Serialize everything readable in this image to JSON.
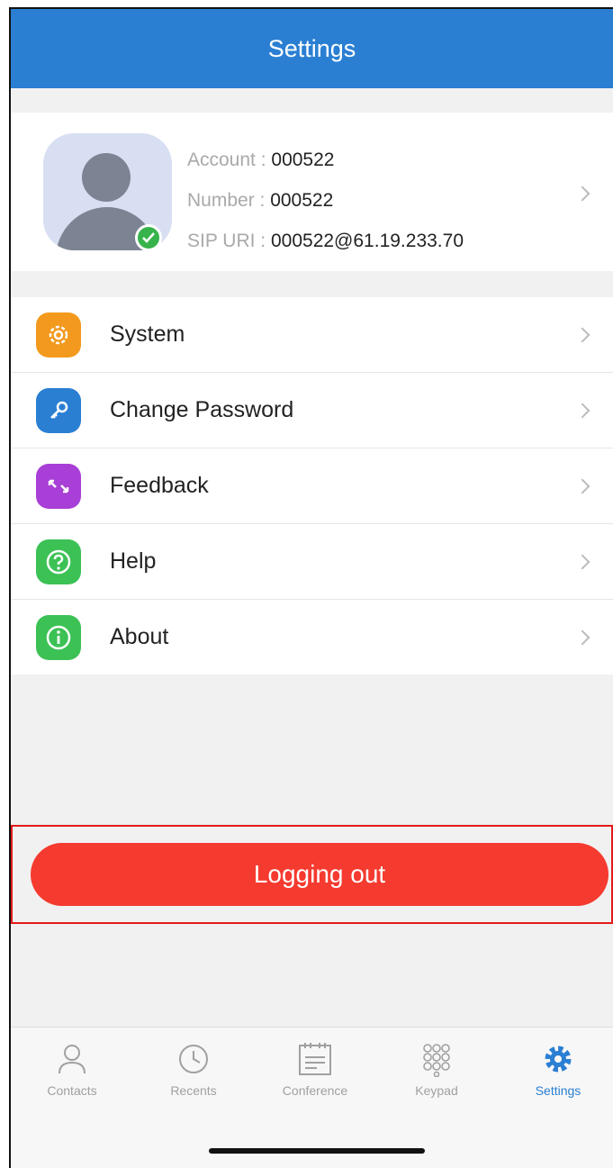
{
  "header": {
    "title": "Settings"
  },
  "profile": {
    "account_label": "Account : ",
    "account_value": "000522",
    "number_label": "Number : ",
    "number_value": "000522",
    "sip_label": "SIP URI : ",
    "sip_value": "000522@61.19.233.70",
    "status": "online"
  },
  "menu": {
    "items": [
      {
        "label": "System",
        "icon": "gear-icon",
        "color": "#f39a1e"
      },
      {
        "label": "Change Password",
        "icon": "key-icon",
        "color": "#2a7fd3"
      },
      {
        "label": "Feedback",
        "icon": "feedback-arrows-icon",
        "color": "#a83fd6"
      },
      {
        "label": "Help",
        "icon": "question-icon",
        "color": "#3cc155"
      },
      {
        "label": "About",
        "icon": "info-icon",
        "color": "#3cc155"
      }
    ]
  },
  "logout": {
    "label": "Logging out",
    "color": "#f53a2f"
  },
  "tabs": [
    {
      "label": "Contacts",
      "icon": "person-icon"
    },
    {
      "label": "Recents",
      "icon": "clock-icon"
    },
    {
      "label": "Conference",
      "icon": "calendar-icon"
    },
    {
      "label": "Keypad",
      "icon": "keypad-icon"
    },
    {
      "label": "Settings",
      "icon": "gear-icon",
      "active": true
    }
  ],
  "colors": {
    "accent": "#2a7fd3",
    "online": "#36b34a"
  }
}
